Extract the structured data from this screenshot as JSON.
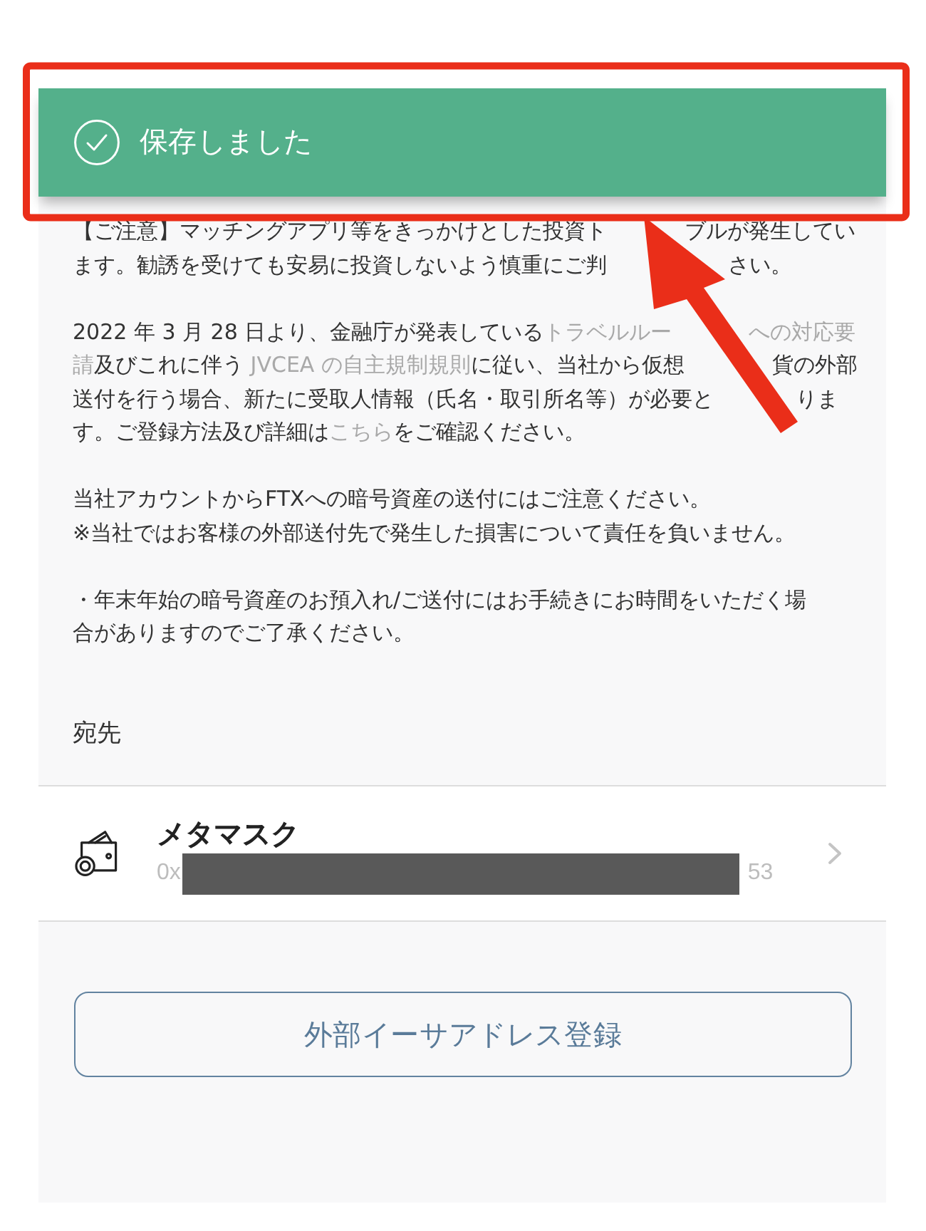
{
  "toast": {
    "message": "保存しました"
  },
  "notices": [
    {
      "lines": [
        {
          "runs": [
            {
              "parts": [
                {
                  "kind": "text",
                  "text": "【ご注意】マッチングアプリ等をきっかけとした投資ト"
                }
              ]
            },
            {
              "parts": [
                {
                  "kind": "text",
                  "text": "ブルが発生してい"
                }
              ]
            }
          ]
        },
        {
          "runs": [
            {
              "parts": [
                {
                  "kind": "text",
                  "text": "ます。勧誘を受けても安易に投資しないよう慎重にご判"
                }
              ]
            },
            {
              "parts": [
                {
                  "kind": "text",
                  "text": "さい。"
                }
              ]
            }
          ]
        }
      ]
    },
    {
      "lines": [
        {
          "runs": [
            {
              "parts": [
                {
                  "kind": "text",
                  "text": "2022 年 3 月 28 日より、金融庁が発表している"
                },
                {
                  "kind": "link",
                  "text": "トラベルルー"
                }
              ]
            },
            {
              "parts": [
                {
                  "kind": "link",
                  "text": "への対応要"
                }
              ]
            }
          ]
        },
        {
          "runs": [
            {
              "parts": [
                {
                  "kind": "link",
                  "text": "請"
                },
                {
                  "kind": "text",
                  "text": "及びこれに伴う "
                },
                {
                  "kind": "link",
                  "text": "JVCEA の自主規制規則"
                },
                {
                  "kind": "text",
                  "text": "に従い、当社から仮想"
                }
              ]
            },
            {
              "parts": [
                {
                  "kind": "text",
                  "text": "貨の外部"
                }
              ]
            }
          ]
        },
        {
          "runs": [
            {
              "parts": [
                {
                  "kind": "text",
                  "text": "送付を行う場合、新たに受取人情報（氏名・取引所名等）が必要と"
                }
              ]
            },
            {
              "parts": [
                {
                  "kind": "text",
                  "text": "りま"
                }
              ]
            }
          ]
        },
        {
          "runs": [
            {
              "parts": [
                {
                  "kind": "text",
                  "text": "す。ご登録方法及び詳細は"
                },
                {
                  "kind": "link",
                  "text": "こちら"
                },
                {
                  "kind": "text",
                  "text": "をご確認ください。"
                }
              ]
            }
          ]
        }
      ]
    },
    {
      "lines": [
        {
          "runs": [
            {
              "parts": [
                {
                  "kind": "text",
                  "text": "当社アカウントからFTXへの暗号資産の送付にはご注意ください。"
                }
              ]
            }
          ]
        },
        {
          "runs": [
            {
              "parts": [
                {
                  "kind": "text",
                  "text": "※当社ではお客様の外部送付先で発生した損害について責任を負いません。"
                }
              ]
            }
          ]
        }
      ]
    },
    {
      "lines": [
        {
          "runs": [
            {
              "parts": [
                {
                  "kind": "text",
                  "text": "・年末年始の暗号資産のお預入れ/ご送付にはお手続きにお時間をいただく場"
                }
              ]
            }
          ]
        },
        {
          "runs": [
            {
              "parts": [
                {
                  "kind": "text",
                  "text": "合がありますのでご了承ください。"
                }
              ]
            }
          ]
        }
      ]
    }
  ],
  "destination": {
    "heading": "宛先",
    "items": [
      {
        "name": "メタマスク",
        "address": {
          "start": "0x",
          "end": "53",
          "redacted": true
        }
      }
    ]
  },
  "register_button": {
    "label": "外部イーサアドレス登録"
  }
}
